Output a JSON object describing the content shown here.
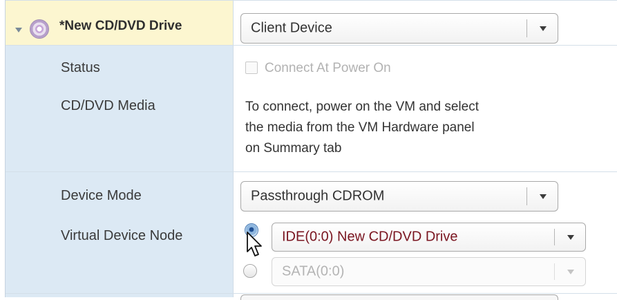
{
  "header": {
    "title": "*New CD/DVD Drive",
    "type_select_value": "Client Device"
  },
  "rows": {
    "status": {
      "label": "Status",
      "checkbox_label": "Connect At Power On",
      "checked": false
    },
    "media": {
      "label": "CD/DVD Media",
      "lines": [
        "To connect, power on the VM and select",
        "the media from the VM Hardware panel",
        "on Summary tab"
      ]
    },
    "device_mode": {
      "label": "Device Mode",
      "value": "Passthrough CDROM"
    },
    "virtual_device_node": {
      "label": "Virtual Device Node",
      "ide_value": "IDE(0:0) New CD/DVD Drive",
      "sata_value": "SATA(0:0)",
      "selected": "ide"
    }
  },
  "icons": {
    "toggle": "chevron-down-icon",
    "device": "cd-dvd-icon",
    "cursor": "mouse-pointer-icon"
  },
  "colors": {
    "header_bg": "#fcf6d0",
    "label_column_bg": "#dce9f4",
    "ide_value_text": "#7a1520"
  }
}
